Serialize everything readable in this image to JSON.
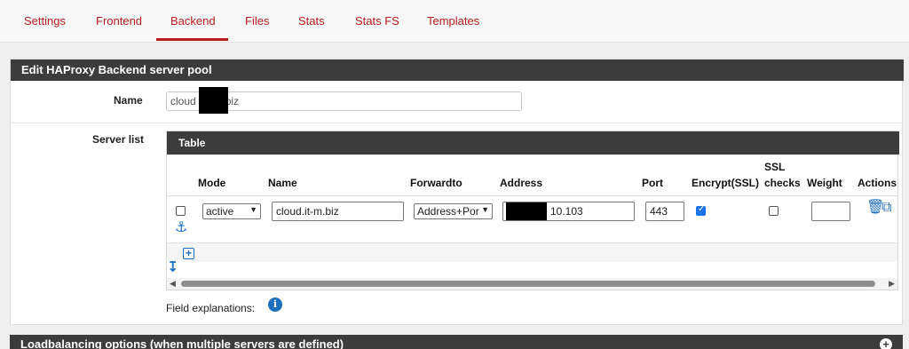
{
  "tabs": [
    {
      "label": "Settings"
    },
    {
      "label": "Frontend"
    },
    {
      "label": "Backend"
    },
    {
      "label": "Files"
    },
    {
      "label": "Stats"
    },
    {
      "label": "Stats FS"
    },
    {
      "label": "Templates"
    }
  ],
  "panel": {
    "title": "Edit HAProxy Backend server pool",
    "name_label": "Name",
    "name_value_prefix": "cloud",
    "name_value_suffix": "biz",
    "server_list_label": "Server list",
    "field_explanations_label": "Field explanations:"
  },
  "table": {
    "title": "Table",
    "headers": {
      "mode": "Mode",
      "name": "Name",
      "forwardto": "Forwardto",
      "address": "Address",
      "port": "Port",
      "encrypt": "Encrypt(SSL)",
      "ssl_line1": "SSL",
      "ssl_line2": "checks",
      "weight": "Weight",
      "actions": "Actions"
    },
    "row": {
      "mode": "active",
      "name": "cloud.it-m.biz",
      "forwardto": "Address+Por",
      "address_suffix": "10.103",
      "port": "443",
      "weight": "",
      "encrypt_checked": true,
      "ssl_checks_checked": false,
      "selected": false
    }
  },
  "panel2": {
    "title": "Loadbalancing options (when multiple servers are defined)"
  },
  "colors": {
    "accent": "#b71c1c",
    "header_bg": "#3c3c3c",
    "icon_blue": "#1f6fbf"
  }
}
